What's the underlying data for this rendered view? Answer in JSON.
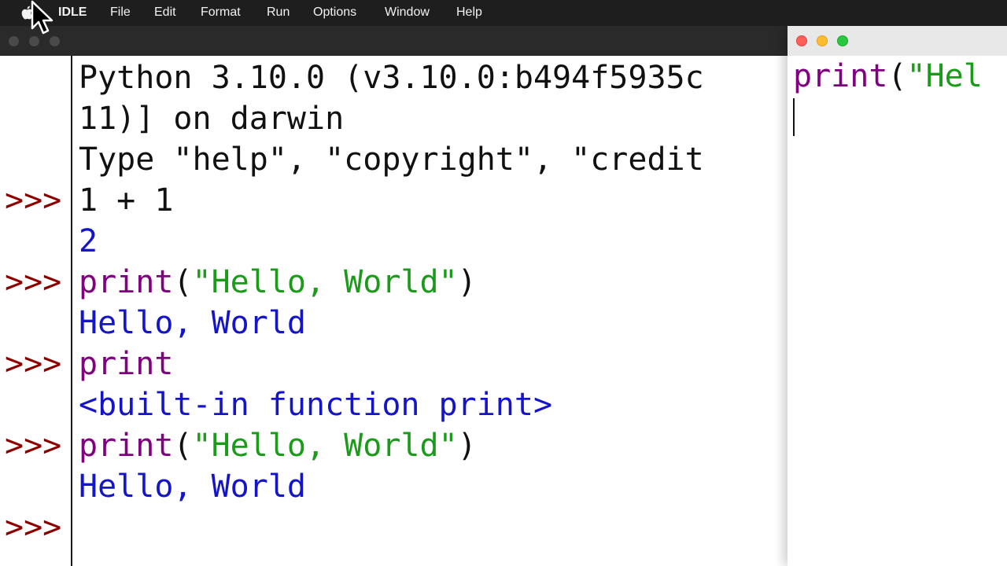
{
  "menubar": {
    "app_name": "IDLE",
    "items": [
      "File",
      "Edit",
      "Format",
      "Run",
      "Options",
      "Window",
      "Help"
    ]
  },
  "shell": {
    "prompt_symbol": ">>>",
    "lines": [
      {
        "segments": [
          {
            "text": "Python 3.10.0 (v3.10.0:b494f5935c",
            "style": "plain"
          }
        ]
      },
      {
        "segments": [
          {
            "text": "11)] on darwin",
            "style": "plain"
          }
        ]
      },
      {
        "segments": [
          {
            "text": "Type \"help\", \"copyright\", \"credit",
            "style": "plain"
          }
        ]
      },
      {
        "prompt": true,
        "segments": [
          {
            "text": "1 + 1",
            "style": "plain"
          }
        ]
      },
      {
        "segments": [
          {
            "text": "2",
            "style": "out"
          }
        ]
      },
      {
        "prompt": true,
        "segments": [
          {
            "text": "print",
            "style": "kw"
          },
          {
            "text": "(",
            "style": "plain"
          },
          {
            "text": "\"Hello, World\"",
            "style": "str"
          },
          {
            "text": ")",
            "style": "plain"
          }
        ]
      },
      {
        "segments": [
          {
            "text": "Hello, World",
            "style": "out"
          }
        ]
      },
      {
        "prompt": true,
        "segments": [
          {
            "text": "print",
            "style": "kw"
          }
        ]
      },
      {
        "segments": [
          {
            "text": "<built-in function print>",
            "style": "out"
          }
        ]
      },
      {
        "prompt": true,
        "segments": [
          {
            "text": "print",
            "style": "kw"
          },
          {
            "text": "(",
            "style": "plain"
          },
          {
            "text": "\"Hello, World\"",
            "style": "str"
          },
          {
            "text": ")",
            "style": "plain"
          }
        ]
      },
      {
        "segments": [
          {
            "text": "Hello, World",
            "style": "out"
          }
        ]
      },
      {
        "prompt": true,
        "segments": []
      }
    ]
  },
  "editor": {
    "line": {
      "segments": [
        {
          "text": "print",
          "style": "kw"
        },
        {
          "text": "(",
          "style": "plain"
        },
        {
          "text": "\"Hel",
          "style": "str"
        }
      ]
    }
  },
  "colors": {
    "prompt": "#8b0000",
    "keyword": "#800080",
    "string": "#1a9c1a",
    "output": "#1414c8",
    "menubar_bg": "#1e1e1e",
    "close": "#ff5f57",
    "minimize": "#febc2e",
    "maximize": "#28c840"
  },
  "icons": {
    "apple": "apple-logo-icon",
    "pointer": "mouse-pointer-icon"
  }
}
